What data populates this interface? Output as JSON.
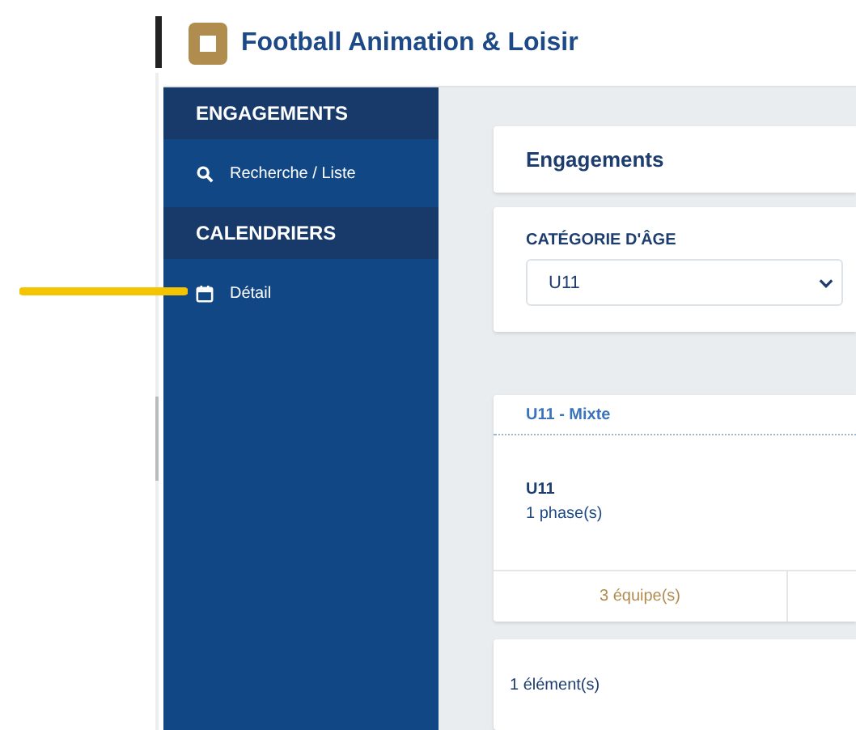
{
  "header": {
    "title": "Football Animation & Loisir"
  },
  "sidebar": {
    "sections": [
      {
        "title": "ENGAGEMENTS",
        "items": [
          {
            "label": "Recherche / Liste",
            "kind": "search"
          }
        ]
      },
      {
        "title": "CALENDRIERS",
        "items": [
          {
            "label": "Détail",
            "kind": "calendar"
          }
        ]
      }
    ]
  },
  "page_title": "Engagements",
  "filter": {
    "label": "CATÉGORIE D'ÂGE",
    "value": "U11"
  },
  "competition": {
    "title": "U11 - Mixte",
    "name": "U11",
    "phases": "1 phase(s)",
    "teams": "3 équipe(s)"
  },
  "result_count": "1 élément(s)"
}
